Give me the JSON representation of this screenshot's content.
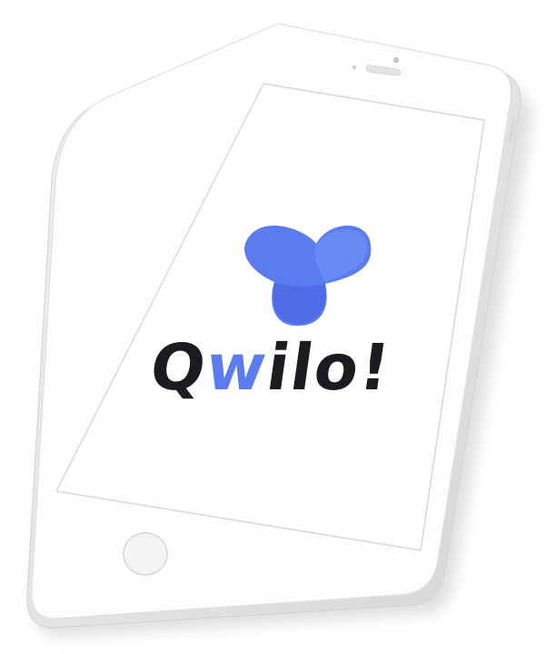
{
  "brand": {
    "wordmark_before": "Q",
    "wordmark_accent": "w",
    "wordmark_after": "ilo!",
    "accent_color": "#5b7bef",
    "logo_colors": [
      "#5b7bef",
      "#6a8cf5",
      "#4f6be6"
    ],
    "text_color": "#1b1c22"
  },
  "device": {
    "body_color": "#fdfdfd",
    "edge_color": "#dedede",
    "screen_color": "#ffffff",
    "icons": [
      "earpiece-icon",
      "camera-icon",
      "front-sensor-icon",
      "home-button-icon"
    ]
  }
}
